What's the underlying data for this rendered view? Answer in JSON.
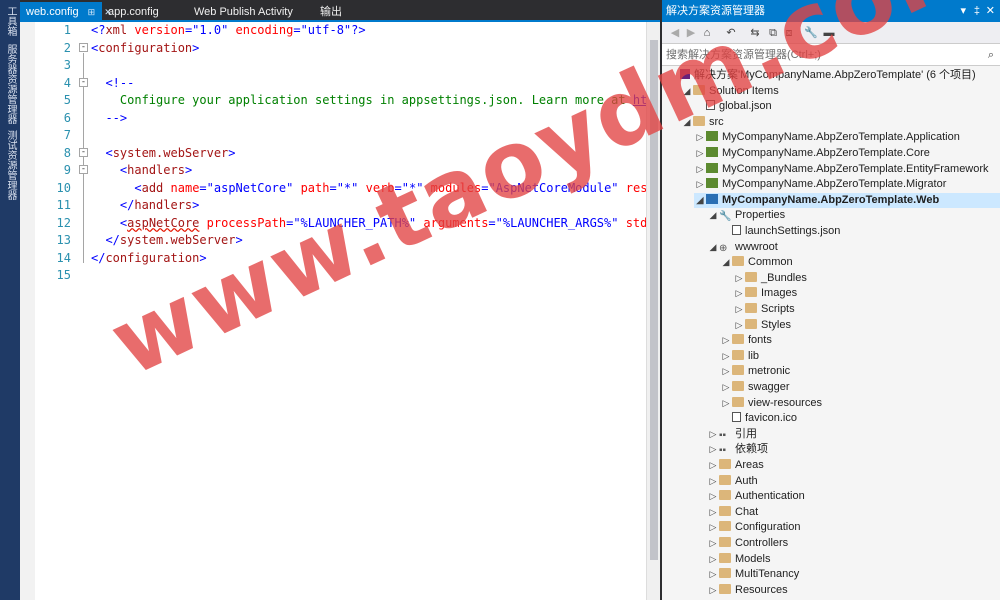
{
  "side_strip": {
    "items": [
      "工具箱",
      "服务器资源管理器",
      "测试资源管理器"
    ]
  },
  "tabs": [
    {
      "label": "web.config",
      "active": true,
      "pin": "⊞",
      "close": "✕"
    },
    {
      "label": "app.config",
      "active": false
    },
    {
      "label": "Web Publish Activity",
      "active": false
    },
    {
      "label": "输出",
      "active": false
    }
  ],
  "editor": {
    "line_numbers": [
      "1",
      "2",
      "3",
      "4",
      "5",
      "6",
      "7",
      "8",
      "9",
      "10",
      "11",
      "12",
      "13",
      "14",
      "15"
    ]
  },
  "panel": {
    "title": "解决方案资源管理器",
    "title_controls": [
      "▾",
      "‡",
      "✕"
    ],
    "toolbar_icons": [
      "◀",
      "▶",
      "⌂",
      "↶",
      "⇆",
      "⧉",
      "⧈",
      "🔧",
      "▬"
    ],
    "search_placeholder": "搜索解决方案资源管理器(Ctrl+;)",
    "search_icon": "⌕",
    "tree": [
      {
        "label": "解决方案'MyCompanyName.AbpZeroTemplate' (6 个项目)",
        "icon": "solution-icon",
        "arrow": "",
        "indent": 0
      },
      {
        "label": "Solution Items",
        "icon": "folder-icon",
        "arrow": "◢",
        "indent": 1
      },
      {
        "label": "global.json",
        "icon": "file-icon",
        "arrow": "",
        "indent": 2
      },
      {
        "label": "src",
        "icon": "folder-icon",
        "arrow": "◢",
        "indent": 1
      },
      {
        "label": "MyCompanyName.AbpZeroTemplate.Application",
        "icon": "csproj-icon",
        "arrow": "▷",
        "indent": 2
      },
      {
        "label": "MyCompanyName.AbpZeroTemplate.Core",
        "icon": "csproj-icon",
        "arrow": "▷",
        "indent": 2
      },
      {
        "label": "MyCompanyName.AbpZeroTemplate.EntityFramework",
        "icon": "csproj-icon",
        "arrow": "▷",
        "indent": 2
      },
      {
        "label": "MyCompanyName.AbpZeroTemplate.Migrator",
        "icon": "csproj-icon",
        "arrow": "▷",
        "indent": 2
      },
      {
        "label": "MyCompanyName.AbpZeroTemplate.Web",
        "icon": "webproj-icon",
        "arrow": "◢",
        "indent": 2,
        "bold": true
      },
      {
        "label": "Properties",
        "icon": "wrench-icon",
        "arrow": "◢",
        "indent": 3
      },
      {
        "label": "launchSettings.json",
        "icon": "file-icon",
        "arrow": "",
        "indent": 4
      },
      {
        "label": "wwwroot",
        "icon": "globe-icon",
        "arrow": "◢",
        "indent": 3
      },
      {
        "label": "Common",
        "icon": "folder-icon",
        "arrow": "◢",
        "indent": 4
      },
      {
        "label": "_Bundles",
        "icon": "folder-icon",
        "arrow": "▷",
        "indent": 5
      },
      {
        "label": "Images",
        "icon": "folder-icon",
        "arrow": "▷",
        "indent": 5
      },
      {
        "label": "Scripts",
        "icon": "folder-icon",
        "arrow": "▷",
        "indent": 5
      },
      {
        "label": "Styles",
        "icon": "folder-icon",
        "arrow": "▷",
        "indent": 5
      },
      {
        "label": "fonts",
        "icon": "folder-icon",
        "arrow": "▷",
        "indent": 4
      },
      {
        "label": "lib",
        "icon": "folder-icon",
        "arrow": "▷",
        "indent": 4
      },
      {
        "label": "metronic",
        "icon": "folder-icon",
        "arrow": "▷",
        "indent": 4
      },
      {
        "label": "swagger",
        "icon": "folder-icon",
        "arrow": "▷",
        "indent": 4
      },
      {
        "label": "view-resources",
        "icon": "folder-icon",
        "arrow": "▷",
        "indent": 4
      },
      {
        "label": "favicon.ico",
        "icon": "file-icon",
        "arrow": "",
        "indent": 4
      },
      {
        "label": "引用",
        "icon": "references-icon",
        "arrow": "▷",
        "indent": 3
      },
      {
        "label": "依赖项",
        "icon": "references-icon",
        "arrow": "▷",
        "indent": 3
      },
      {
        "label": "Areas",
        "icon": "folder-icon",
        "arrow": "▷",
        "indent": 3
      },
      {
        "label": "Auth",
        "icon": "folder-icon",
        "arrow": "▷",
        "indent": 3
      },
      {
        "label": "Authentication",
        "icon": "folder-icon",
        "arrow": "▷",
        "indent": 3
      },
      {
        "label": "Chat",
        "icon": "folder-icon",
        "arrow": "▷",
        "indent": 3
      },
      {
        "label": "Configuration",
        "icon": "folder-icon",
        "arrow": "▷",
        "indent": 3
      },
      {
        "label": "Controllers",
        "icon": "folder-icon",
        "arrow": "▷",
        "indent": 3
      },
      {
        "label": "Models",
        "icon": "folder-icon",
        "arrow": "▷",
        "indent": 3
      },
      {
        "label": "MultiTenancy",
        "icon": "folder-icon",
        "arrow": "▷",
        "indent": 3
      },
      {
        "label": "Resources",
        "icon": "folder-icon",
        "arrow": "▷",
        "indent": 3
      }
    ]
  },
  "watermark": "www.taoydm.com",
  "colors": {
    "accent": "#007acc",
    "keyword": "#0000ff",
    "element": "#a31515",
    "attribute": "#ff0000",
    "comment": "#008000"
  }
}
